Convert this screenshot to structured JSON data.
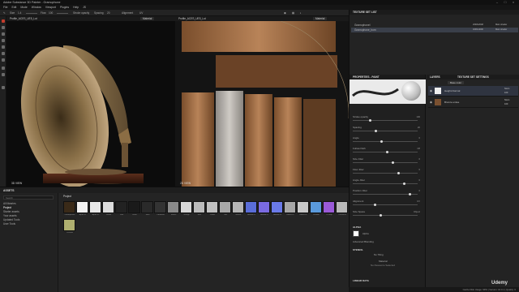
{
  "window": {
    "title": "Adobe Substance 3D Painter - Gramophone"
  },
  "menu": [
    "File",
    "Edit",
    "Mode",
    "Window",
    "Viewport",
    "Plugins",
    "Help",
    "JS"
  ],
  "toolbar": {
    "size_label": "Size",
    "size_val": "1.4",
    "flow_label": "Flow",
    "flow_val": "100",
    "spacing_label": "Spacing",
    "spacing_val": "20",
    "alignment_label": "Alignment",
    "alignment_val": "UV",
    "stroke_label": "Stroke opacity"
  },
  "viewport3d": {
    "title": "Profile_ACES_UE5_Lut",
    "mode": "Material",
    "foot": "3D VIEW"
  },
  "viewport2d": {
    "title": "Profile_ACES_UE5_Lut",
    "mode": "Material",
    "foot": "2D VIEW"
  },
  "assets": {
    "title": "ASSETS",
    "search_placeholder": "Search",
    "tab": "Project",
    "libraries": [
      "All libraries",
      "Project",
      "Starter assets",
      "Your assets",
      "Updated Tools",
      "User Tools"
    ],
    "thumbs": [
      {
        "label": "Gramophone",
        "color": "#3a2a18"
      },
      {
        "label": "Alpha 01",
        "color": "#f2f2f2"
      },
      {
        "label": "Alpha 02",
        "color": "#e8e8e8"
      },
      {
        "label": "Flower",
        "color": "#dcdcdc"
      },
      {
        "label": "Leaf",
        "color": "#222"
      },
      {
        "label": "Wave",
        "color": "#1a1a1a"
      },
      {
        "label": "Swirl",
        "color": "#2a2a2a"
      },
      {
        "label": "Ornament",
        "color": "#333"
      },
      {
        "label": "Stencil",
        "color": "#8a8a8a"
      },
      {
        "label": "Grunge",
        "color": "#d8d8d8"
      },
      {
        "label": "Bars",
        "color": "#bbb"
      },
      {
        "label": "Planks",
        "color": "#c0c0c0"
      },
      {
        "label": "Tiles",
        "color": "#a8a8a8"
      },
      {
        "label": "Mosaic",
        "color": "#b5b5b5"
      },
      {
        "label": "Normal 01",
        "color": "#5a6dd8"
      },
      {
        "label": "Normal 02",
        "color": "#7a6ae0"
      },
      {
        "label": "Normal 03",
        "color": "#6a7ae8"
      },
      {
        "label": "Baked 01",
        "color": "#a6a6a6"
      },
      {
        "label": "Baked 02",
        "color": "#c8c8c8"
      },
      {
        "label": "Position",
        "color": "#5a9adc"
      },
      {
        "label": "ID Map",
        "color": "#9a5ad8"
      },
      {
        "label": "Thickness",
        "color": "#b8b8b8"
      },
      {
        "label": "Checker",
        "color": "#b0b070"
      }
    ]
  },
  "texture_sets": {
    "title": "TEXTURE SET LIST",
    "rows": [
      {
        "name": "GramophoneI",
        "res": "2048x2048",
        "shader": "Main shader"
      },
      {
        "name": "Gramophone_horn",
        "res": "4096x4096",
        "shader": "Main shader"
      }
    ]
  },
  "properties": {
    "title": "PROPERTIES - PAINT",
    "fields": [
      {
        "label": "Stroke opacity",
        "val": "100"
      },
      {
        "label": "Spacing",
        "val": "20"
      },
      {
        "label": "Angle",
        "val": "0"
      },
      {
        "label": "Follow Path",
        "val": "Off"
      },
      {
        "label": "Size Jitter",
        "val": "0"
      },
      {
        "label": "Flow Jitter",
        "val": "0"
      },
      {
        "label": "Angle Jitter",
        "val": "0"
      },
      {
        "label": "Position Jitter",
        "val": "0"
      },
      {
        "label": "Alignment",
        "val": "UV"
      },
      {
        "label": "Size Space",
        "val": "Object"
      }
    ],
    "alpha_title": "ALPHA",
    "alpha_name": "Alpha",
    "adv_label": "Advanced Blending",
    "stencil_title": "STENCIL",
    "stencil_val": "No Tiling",
    "material_label": "Material",
    "material_val": "No Resource Selected",
    "lineart_title": "LINEAR DATA"
  },
  "layers": {
    "title": "LAYERS",
    "tab2": "TEXTURE SET SETTINGS",
    "mode": "Base color",
    "rows": [
      {
        "name": "Height-Normal",
        "blend": "Norm",
        "op": "100"
      },
      {
        "name": "Bronze emise",
        "blend": "Norm",
        "op": "100"
      }
    ]
  },
  "status": {
    "text": "Cache Disk Usage: 99%  |  Version: 10.0.1  |  Quality: 0"
  },
  "watermark": "Udemy"
}
